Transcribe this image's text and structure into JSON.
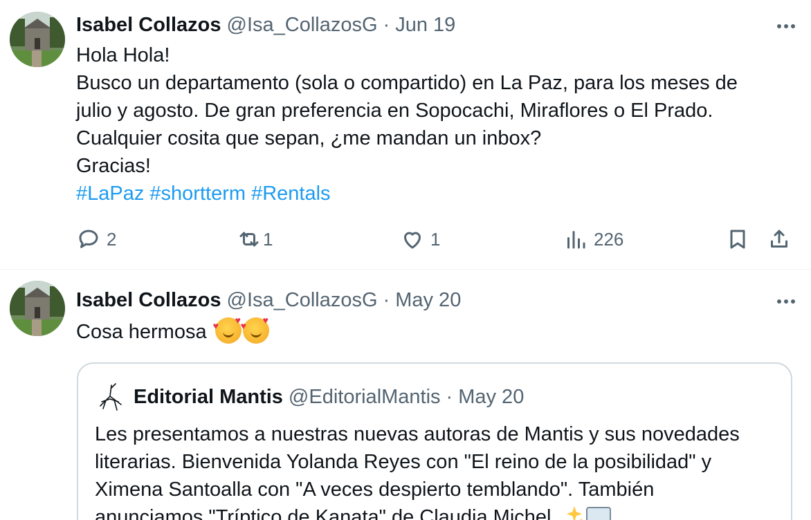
{
  "tweets": [
    {
      "author_name": "Isabel Collazos",
      "handle": "@Isa_CollazosG",
      "separator": "·",
      "date": "Jun 19",
      "lines": [
        "Hola Hola!",
        "Busco un departamento (sola o compartido) en La Paz, para los meses de",
        "julio y agosto. De gran preferencia en Sopocachi, Miraflores o El Prado.",
        "Cualquier cosita que sepan, ¿me mandan un inbox?",
        "Gracias!"
      ],
      "hashtags": [
        "#LaPaz",
        "#shortterm",
        "#Rentals"
      ],
      "actions": {
        "replies": "2",
        "reposts": "1",
        "likes": "1",
        "views": "226"
      }
    },
    {
      "author_name": "Isabel Collazos",
      "handle": "@Isa_CollazosG",
      "separator": "·",
      "date": "May 20",
      "text": "Cosa hermosa",
      "emoji": [
        "smiling-face-with-hearts",
        "smiling-face-with-hearts"
      ],
      "quote": {
        "author_name": "Editorial Mantis",
        "handle": "@EditorialMantis",
        "separator": "·",
        "date": "May 20",
        "lines": [
          "Les presentamos a nuestras nuevas autoras de Mantis y sus novedades",
          "literarias. Bienvenida Yolanda Reyes con \"El reino de la posibilidad\" y",
          "Ximena Santoalla con \"A veces despierto temblando\". También",
          "anunciamos \"Tríptico de Kanata\" de Claudia Michel."
        ],
        "trailing_emoji": [
          "sparkles",
          "book"
        ]
      }
    }
  ],
  "colors": {
    "text": "#0f1419",
    "secondary": "#536471",
    "link": "#1d9bf0",
    "border": "#cfd9de",
    "divider": "#eff3f4"
  }
}
